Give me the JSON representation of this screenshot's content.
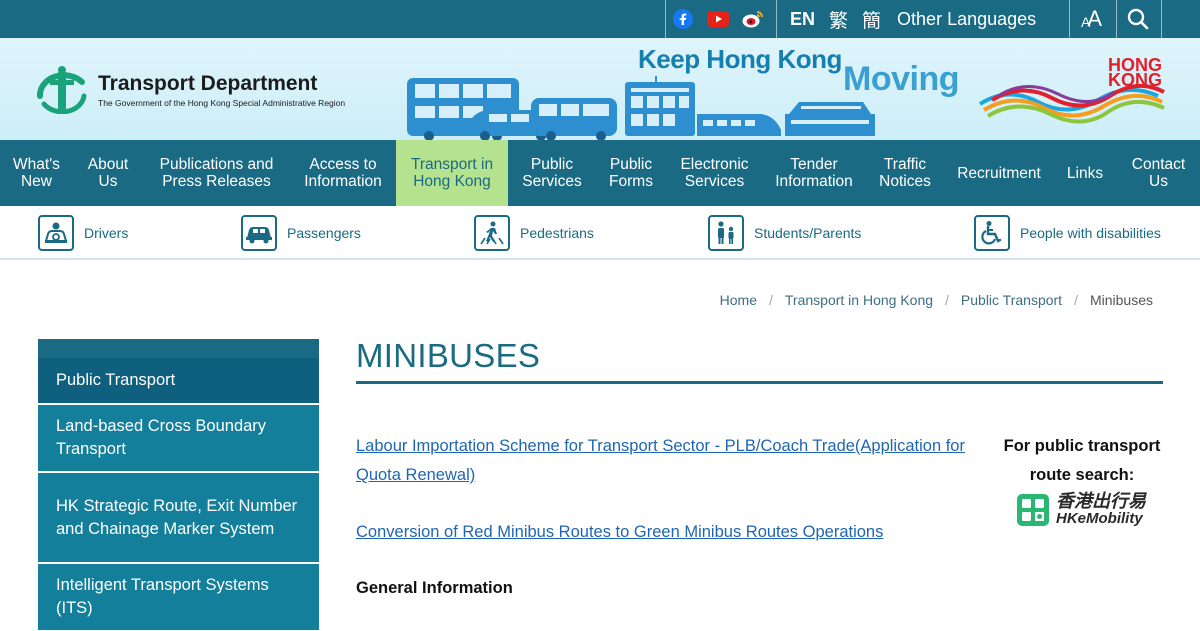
{
  "topbar": {
    "social": [
      "facebook-icon",
      "youtube-icon",
      "weibo-icon"
    ],
    "lang_en": "EN",
    "lang_tc": "繁",
    "lang_sc": "簡",
    "other_languages": "Other Languages",
    "font_size_label": "A"
  },
  "header": {
    "dept_name": "Transport Department",
    "dept_sub": "The Government of the Hong Kong Special Administrative Region",
    "slogan_line1": "Keep Hong Kong",
    "slogan_line2": "Moving",
    "brand_line1": "HONG",
    "brand_line2": "KONG"
  },
  "nav": {
    "items": [
      {
        "label": "What's New"
      },
      {
        "label": "About Us"
      },
      {
        "label": "Publications and Press Releases"
      },
      {
        "label": "Access to Information"
      },
      {
        "label": "Transport in Hong Kong"
      },
      {
        "label": "Public Services"
      },
      {
        "label": "Public Forms"
      },
      {
        "label": "Electronic Services"
      },
      {
        "label": "Tender Information"
      },
      {
        "label": "Traffic Notices"
      },
      {
        "label": "Recruitment"
      },
      {
        "label": "Links"
      },
      {
        "label": "Contact Us"
      }
    ]
  },
  "audience": {
    "items": [
      {
        "label": "Drivers",
        "icon": "driver-icon"
      },
      {
        "label": "Passengers",
        "icon": "car-icon"
      },
      {
        "label": "Pedestrians",
        "icon": "pedestrian-crossing-icon"
      },
      {
        "label": "Students/Parents",
        "icon": "family-icon"
      },
      {
        "label": "People with disabilities",
        "icon": "wheelchair-icon"
      }
    ]
  },
  "breadcrumb": {
    "home": "Home",
    "level1": "Transport in Hong Kong",
    "level2": "Public Transport",
    "current": "Minibuses"
  },
  "sidebar": {
    "items": [
      {
        "label": "Public Transport"
      },
      {
        "label": "Land-based Cross Boundary Transport"
      },
      {
        "label": "HK Strategic Route, Exit Number and Chainage Marker System"
      },
      {
        "label": "Intelligent Transport Systems (ITS)"
      }
    ]
  },
  "main": {
    "title": "MINIBUSES",
    "link1": "Labour Importation Scheme for Transport Sector - PLB/Coach Trade(Application for Quota Renewal)",
    "link2": "Conversion of Red Minibus Routes to Green Minibus Routes Operations",
    "general_heading": "General Information"
  },
  "promo": {
    "heading": "For public transport route search:",
    "app_name_zh": "香港出行易",
    "app_name_en": "HKeMobility"
  },
  "colors": {
    "primary": "#1a6a84",
    "nav_active": "#b5e28f",
    "sidebar": "#147f9b",
    "link": "#1f66b0"
  }
}
